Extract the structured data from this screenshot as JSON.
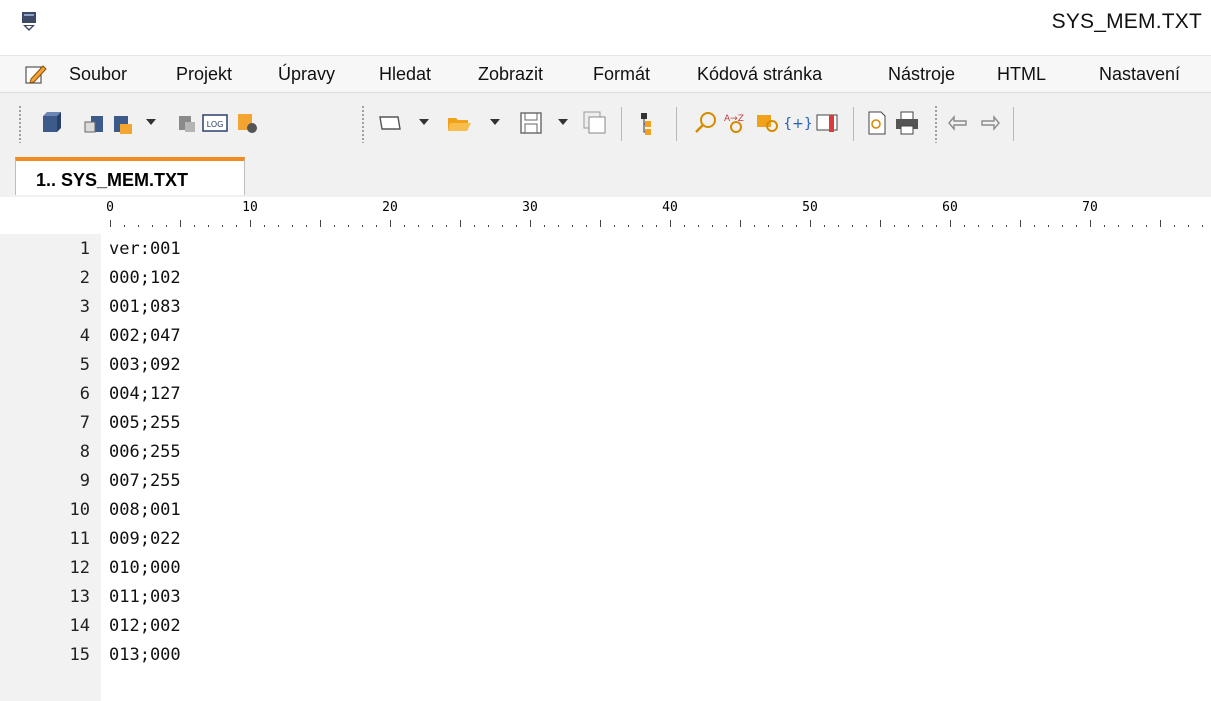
{
  "window": {
    "title": "SYS_MEM.TXT"
  },
  "menu": [
    "Soubor",
    "Projekt",
    "Úpravy",
    "Hledat",
    "Zobrazit",
    "Formát",
    "Kódová stránka",
    "Nástroje",
    "HTML",
    "Nastavení"
  ],
  "tabs": [
    {
      "label": "1.. SYS_MEM.TXT",
      "active": true
    }
  ],
  "ruler": {
    "labels": [
      "0",
      "10",
      "20",
      "30",
      "40",
      "50",
      "60",
      "70"
    ]
  },
  "editor": {
    "lines": [
      {
        "num": "1",
        "text": "ver:001"
      },
      {
        "num": "2",
        "text": "000;102"
      },
      {
        "num": "3",
        "text": "001;083"
      },
      {
        "num": "4",
        "text": "002;047"
      },
      {
        "num": "5",
        "text": "003;092"
      },
      {
        "num": "6",
        "text": "004;127"
      },
      {
        "num": "7",
        "text": "005;255"
      },
      {
        "num": "8",
        "text": "006;255"
      },
      {
        "num": "9",
        "text": "007;255"
      },
      {
        "num": "10",
        "text": "008;001"
      },
      {
        "num": "11",
        "text": "009;022"
      },
      {
        "num": "12",
        "text": "010;000"
      },
      {
        "num": "13",
        "text": "011;003"
      },
      {
        "num": "14",
        "text": "012;002"
      },
      {
        "num": "15",
        "text": "013;000"
      }
    ]
  },
  "colors": {
    "tab_accent": "#f28b1f",
    "gutter": "#f2f2f2",
    "toolbar": "#f1f1f1"
  }
}
